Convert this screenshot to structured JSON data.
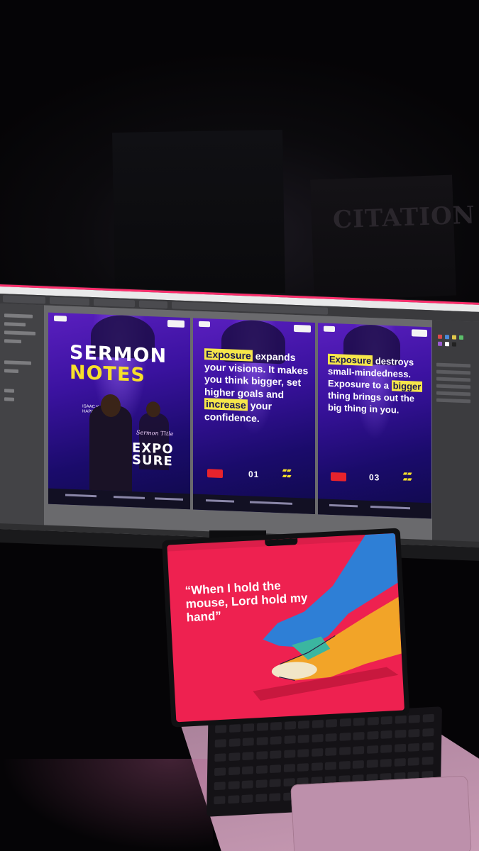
{
  "scene": {
    "wall_poster_text": "CITATION"
  },
  "monitor": {
    "app": "photoshop",
    "artboards": [
      {
        "kind": "cover",
        "title_line1": "SERMON",
        "title_line2": "NOTES",
        "speaker_line1": "ISAAC K.",
        "speaker_line2": "HAPAIYO",
        "script_title": "Sermon Title",
        "series_word_top": "EXPO",
        "series_word_bottom": "SURE"
      },
      {
        "kind": "quote",
        "page_number": "01",
        "parts": [
          {
            "text": "Exposure",
            "highlight": true
          },
          {
            "text": " expands your visions. It makes you think bigger, set higher goals and ",
            "highlight": false
          },
          {
            "text": "increase",
            "highlight": true
          },
          {
            "text": " your confidence.",
            "highlight": false
          }
        ]
      },
      {
        "kind": "quote",
        "page_number": "03",
        "parts": [
          {
            "text": "Exposure",
            "highlight": true
          },
          {
            "text": " destroys small-mindedness. Exposure to a ",
            "highlight": false
          },
          {
            "text": "bigger",
            "highlight": true
          },
          {
            "text": " thing brings out the big thing in you.",
            "highlight": false
          }
        ]
      }
    ]
  },
  "laptop": {
    "wallpaper_quote": "“When I hold the mouse, Lord hold my hand”",
    "wallpaper_color": "#ee2150",
    "hand_colors": [
      "#2e7fd6",
      "#f2a428"
    ]
  }
}
